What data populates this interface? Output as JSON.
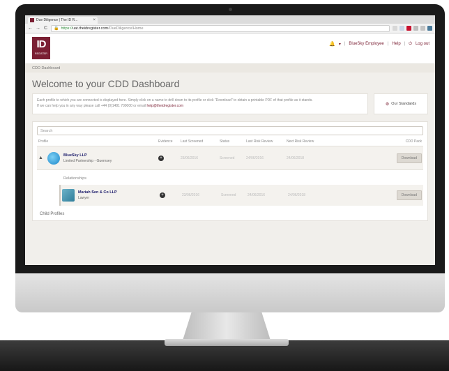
{
  "browser": {
    "tab_title": "Due Diligence | The ID R...",
    "tab_close": "×",
    "url_secure": "https://",
    "url_host": "uat.theidregister.com",
    "url_path": "/DueDiligence/Home",
    "back": "←",
    "forward": "→",
    "reload": "C",
    "lock_glyph": "🔒",
    "extension_colors": [
      "#d8d8d8",
      "#c9d6e6",
      "#c8102e",
      "#bdbdbd",
      "#c4c4c4",
      "#4a7a9a"
    ]
  },
  "header": {
    "logo_letters": "ID",
    "logo_sub": "REGISTER",
    "logo_color": "#7a1f33",
    "bell_glyph": "🔔",
    "bell_caret": "▾",
    "sep": "|",
    "user": "BlueSky Employee",
    "help": "Help",
    "logout_glyph": "⏻",
    "logout": "Log out"
  },
  "breadcrumb": "CDD Dashboard",
  "page": {
    "title": "Welcome to your CDD Dashboard",
    "intro_line1": "Each profile to which you are connected is displayed here. Simply click on a name to drill down to its profile or click \"Download\" to obtain a printable PDF of that profile as it stands.",
    "intro_line2": "If we can help you in any way please call +44 (0)1481 700000 or email",
    "intro_email": "help@theidregister.com",
    "standards_icon": "⚙",
    "standards": "Our Standards"
  },
  "table": {
    "search_placeholder": "Search",
    "columns": {
      "profile": "Profile",
      "evidence": "Evidence",
      "last_screened": "Last Screened",
      "status": "Status",
      "last_risk": "Last Risk Review",
      "next_risk": "Next Risk Review",
      "cdd_pack": "CDD Pack"
    },
    "main_row": {
      "expander": "▲",
      "name": "BlueSky LLP",
      "type": "Limited Partnership - Guernsey",
      "evidence_glyph": "+",
      "last_screened": "23/06/2016",
      "status": "Screened",
      "last_risk": "24/06/2016",
      "next_risk": "24/06/2018",
      "download": "Download"
    },
    "relationships_label": "Relationships",
    "relationship_row": {
      "name": "Mariah Sen & Co LLP",
      "type": "Lawyer",
      "evidence_glyph": "+",
      "last_screened": "23/06/2016",
      "status": "Screened",
      "last_risk": "24/06/2016",
      "next_risk": "24/06/2018",
      "download": "Download"
    },
    "child_profiles_label": "Child Profiles"
  }
}
